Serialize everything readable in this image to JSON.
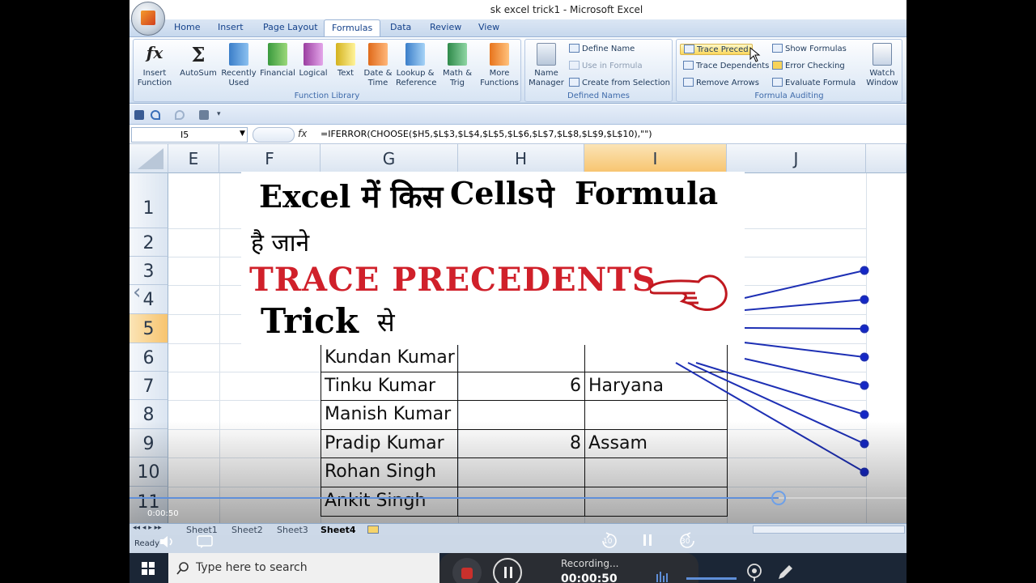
{
  "window": {
    "title": "sk excel trick1 - Microsoft Excel"
  },
  "ribbon": {
    "tabs": [
      "Home",
      "Insert",
      "Page Layout",
      "Formulas",
      "Data",
      "Review",
      "View"
    ],
    "active_tab": "Formulas",
    "groups": {
      "function_library": {
        "label": "Function Library",
        "buttons": [
          "Insert Function",
          "AutoSum",
          "Recently Used",
          "Financial",
          "Logical",
          "Text",
          "Date & Time",
          "Lookup & Reference",
          "Math & Trig",
          "More Functions"
        ]
      },
      "defined_names": {
        "label": "Defined Names",
        "name_manager": "Name Manager",
        "define_name": "Define Name",
        "use_in_formula": "Use in Formula",
        "create_from_selection": "Create from Selection"
      },
      "formula_auditing": {
        "label": "Formula Auditing",
        "trace_precedents": "Trace Preced",
        "trace_dependents": "Trace Dependents",
        "remove_arrows": "Remove Arrows",
        "show_formulas": "Show Formulas",
        "error_checking": "Error Checking",
        "evaluate_formula": "Evaluate Formula",
        "watch_window": "Watch Window"
      }
    }
  },
  "formula_bar": {
    "name_box": "I5",
    "fx": "fx",
    "formula": "=IFERROR(CHOOSE($H5,$L$3,$L$4,$L$5,$L$6,$L$7,$L$8,$L$9,$L$10),\"\")"
  },
  "grid": {
    "columns": [
      "E",
      "F",
      "G",
      "H",
      "I",
      "J"
    ],
    "selected_column": "I",
    "rows": [
      "1",
      "2",
      "3",
      "4",
      "5",
      "6",
      "7",
      "8",
      "9",
      "10",
      "11"
    ],
    "selected_row": "5",
    "table_rows": [
      {
        "name": "Kundan Kumar",
        "num": "",
        "state": ""
      },
      {
        "name": "Tinku Kumar",
        "num": "6",
        "state": "Haryana"
      },
      {
        "name": "Manish Kumar",
        "num": "",
        "state": ""
      },
      {
        "name": "Pradip Kumar",
        "num": "8",
        "state": "Assam"
      },
      {
        "name": "Rohan Singh",
        "num": "",
        "state": ""
      },
      {
        "name": "Ankit Singh",
        "num": "",
        "state": ""
      }
    ]
  },
  "overlay": {
    "line1_a": "Excel में किस",
    "line1_b": "Cells",
    "line1_c": "पे",
    "line1_d": "Formula",
    "line2": "है जाने",
    "line3": "TRACE PRECEDENTS",
    "line4_a": "Trick",
    "line4_b": "से",
    "accent_color": "#d0202a"
  },
  "player": {
    "time": "0:00:50",
    "back_label": "10",
    "forward_label": "30"
  },
  "sheet_tabs": [
    "Sheet1",
    "Sheet2",
    "Sheet3",
    "Sheet4"
  ],
  "active_sheet": "Sheet4",
  "status": {
    "text": "Ready"
  },
  "taskbar": {
    "search_placeholder": "Type here to search",
    "recording_label": "Recording...",
    "recording_time": "00:00:50"
  }
}
